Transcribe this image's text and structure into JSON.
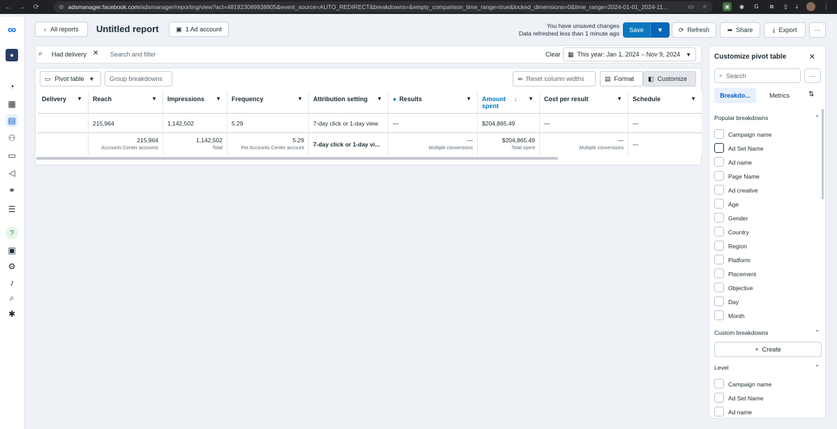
{
  "browser": {
    "url_domain": "adsmanager.facebook.com",
    "url_path": "/adsmanager/reporting/view?act=481923089938805&event_source=AUTO_REDIRECT&breakdowns=&empty_comparison_time_range=true&locked_dimensions=0&time_range=2024-01-01_2024-11..."
  },
  "header": {
    "back_label": "All reports",
    "title": "Untitled report",
    "account_label": "1 Ad account",
    "unsaved_line1": "You have unsaved changes",
    "unsaved_line2": "Data refreshed less than 1 minute ago",
    "save_label": "Save",
    "refresh_label": "Refresh",
    "share_label": "Share",
    "export_label": "Export",
    "more_label": "···"
  },
  "filter": {
    "chip": "Had delivery",
    "placeholder": "Search and filter",
    "clear_label": "Clear",
    "date_range": "This year: Jan 1, 2024 – Nov 9, 2024"
  },
  "toolbar": {
    "pivot_label": "Pivot table",
    "group_label": "Group breakdowns",
    "reset_label": "Reset column widths",
    "format_label": "Format",
    "customize_label": "Customize"
  },
  "table": {
    "columns": [
      "Delivery",
      "Reach",
      "Impressions",
      "Frequency",
      "Attribution setting",
      "Results",
      "Amount spent",
      "Cost per result",
      "Schedule"
    ],
    "row1": [
      "",
      "215,964",
      "1,142,502",
      "5.29",
      "7-day click or 1-day view",
      "—",
      "$204,865.49",
      "—",
      "—"
    ],
    "totals": {
      "reach": "215,964",
      "reach_sub": "Accounts Center accounts",
      "impressions": "1,142,502",
      "impressions_sub": "Total",
      "frequency": "5.29",
      "frequency_sub": "Per Accounts Center account",
      "attribution": "7-day click or 1-day vi...",
      "results": "—",
      "results_sub": "Multiple conversions",
      "amount": "$204,865.49",
      "amount_sub": "Total spent",
      "cpr": "—",
      "cpr_sub": "Multiple conversions",
      "schedule": "—"
    }
  },
  "panel": {
    "title": "Customize pivot table",
    "search_placeholder": "Search",
    "more_label": "···",
    "tabs": [
      "Breakdo...",
      "Metrics"
    ],
    "popular_title": "Popular breakdowns",
    "popular": [
      "Campaign name",
      "Ad Set Name",
      "Ad name",
      "Page Name",
      "Ad creative",
      "Age",
      "Gender",
      "Country",
      "Region",
      "Platform",
      "Placement",
      "Objective",
      "Day",
      "Month"
    ],
    "custom_title": "Custom breakdowns",
    "create_label": "Create",
    "level_title": "Level",
    "level": [
      "Campaign name",
      "Ad Set Name",
      "Ad name"
    ]
  },
  "colors": {
    "accent": "#0a78be",
    "brand": "#0866ff"
  }
}
